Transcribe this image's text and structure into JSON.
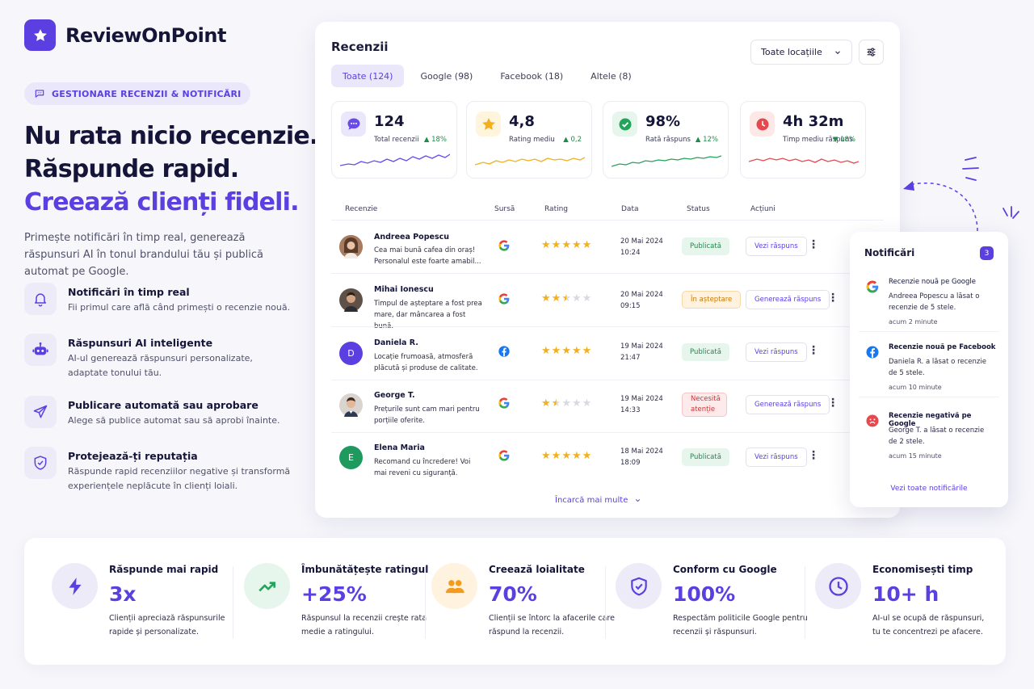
{
  "brand": {
    "name": "ReviewOnPoint"
  },
  "hero": {
    "pill": "GESTIONARE RECENZII & NOTIFICĂRI",
    "line1": "Nu rata nicio recenzie.",
    "line2": "Răspunde rapid.",
    "line3": "Creează clienți fideli.",
    "subtitle": "Primește notificări în timp real, generează răspunsuri AI în tonul brandului tău și publică automat pe Google."
  },
  "features": [
    {
      "title": "Notificări în timp real",
      "desc": "Fii primul care află când primești o recenzie nouă.",
      "icon": "bell-icon"
    },
    {
      "title": "Răspunsuri AI inteligente",
      "desc": "AI-ul generează răspunsuri personalizate, adaptate tonului tău.",
      "icon": "robot-icon"
    },
    {
      "title": "Publicare automată sau aprobare",
      "desc": "Alege să publice automat sau să aprobi înainte.",
      "icon": "send-icon"
    },
    {
      "title": "Protejează-ți reputația",
      "desc": "Răspunde rapid recenziilor negative și transformă experiențele neplăcute în clienți loiali.",
      "icon": "shield-icon"
    }
  ],
  "panel": {
    "title": "Recenzii",
    "location": "Toate locațiile",
    "tabs": [
      "Toate (124)",
      "Google (98)",
      "Facebook (18)",
      "Altele (8)"
    ],
    "load_more": "Încarcă mai multe"
  },
  "kpis": [
    {
      "value": "124",
      "label": "Total recenzii",
      "delta": "▲ 18%",
      "color": "#6b4be8",
      "delta_color": "#1f8a4a",
      "icon": "chat-icon"
    },
    {
      "value": "4,8",
      "label": "Rating mediu",
      "delta": "▲ 0,2",
      "color": "#f2b01e",
      "delta_color": "#1f8a4a",
      "icon": "star-icon"
    },
    {
      "value": "98%",
      "label": "Rată răspuns",
      "delta": "▲ 12%",
      "color": "#22a45a",
      "delta_color": "#1f8a4a",
      "icon": "check-icon"
    },
    {
      "value": "4h 32m",
      "label": "Timp mediu răspuns",
      "delta": "▼ 18%",
      "color": "#e5484d",
      "delta_color": "#1f8a4a",
      "icon": "clock-icon"
    }
  ],
  "table": {
    "headers": [
      "Recenzie",
      "Sursă",
      "Rating",
      "Data",
      "Status",
      "Acțiuni"
    ],
    "rows": [
      {
        "name": "Andreea Popescu",
        "text": "Cea mai bună cafea din oraș! Personalul este foarte amabil...",
        "source": "google",
        "rating": 5,
        "date": "20 Mai 2024",
        "time": "10:24",
        "status": "Publicată",
        "status_type": "pub",
        "action": "Vezi răspuns",
        "initial": "",
        "avatar_color": "#b98867"
      },
      {
        "name": "Mihai Ionescu",
        "text": "Timpul de așteptare a fost prea mare, dar mâncarea a fost bună.",
        "source": "google",
        "rating": 2.5,
        "date": "20 Mai 2024",
        "time": "09:15",
        "status": "În așteptare",
        "status_type": "wait",
        "action": "Generează răspuns",
        "initial": "",
        "avatar_color": "#6f5b4c"
      },
      {
        "name": "Daniela R.",
        "text": "Locație frumoasă, atmosferă plăcută și produse de calitate.",
        "source": "facebook",
        "rating": 5,
        "date": "19 Mai 2024",
        "time": "21:47",
        "status": "Publicată",
        "status_type": "pub",
        "action": "Vezi răspuns",
        "initial": "D",
        "avatar_color": "#5b3fe0"
      },
      {
        "name": "George T.",
        "text": "Prețurile sunt cam mari pentru porțiile oferite.",
        "source": "google",
        "rating": 1.5,
        "date": "19 Mai 2024",
        "time": "14:33",
        "status": "Necesită atenție",
        "status_type": "need",
        "action": "Generează răspuns",
        "initial": "",
        "avatar_color": "#8a7a70"
      },
      {
        "name": "Elena Maria",
        "text": "Recomand cu încredere! Voi mai reveni cu siguranță.",
        "source": "google",
        "rating": 5,
        "date": "18 Mai 2024",
        "time": "18:09",
        "status": "Publicată",
        "status_type": "pub",
        "action": "Vezi răspuns",
        "initial": "E",
        "avatar_color": "#1f9a5e"
      }
    ]
  },
  "notifications": {
    "title": "Notificări",
    "count": "3",
    "items": [
      {
        "head": "Recenzie nouă pe Google",
        "body": "Andreea Popescu a lăsat o recenzie de 5 stele.",
        "time": "acum 2 minute",
        "icon": "google"
      },
      {
        "head": "Recenzie nouă pe Facebook",
        "body": "Daniela R. a lăsat o recenzie de 5 stele.",
        "time": "acum 10 minute",
        "icon": "facebook"
      },
      {
        "head": "Recenzie negativă pe Google",
        "body": "George T. a lăsat o recenzie de 2 stele.",
        "time": "acum 15 minute",
        "icon": "sad"
      }
    ],
    "see_all": "Vezi toate notificările"
  },
  "stats": [
    {
      "title": "Răspunde mai rapid",
      "value": "3x",
      "desc": "Clienții apreciază răspunsurile rapide și personalizate.",
      "icon": "lightning-icon",
      "bg": "#ecebf7"
    },
    {
      "title": "Îmbunătățește ratingul",
      "value": "+25%",
      "desc": "Răspunsul la recenzii crește rata medie a ratingului.",
      "icon": "trend-up-icon",
      "bg": "#e6f6ec"
    },
    {
      "title": "Creează loialitate",
      "value": "70%",
      "desc": "Clienții se întorc la afacerile care răspund la recenzii.",
      "icon": "users-icon",
      "bg": "#fff3e0"
    },
    {
      "title": "Conform cu Google",
      "value": "100%",
      "desc": "Respectăm politicile Google pentru recenzii și răspunsuri.",
      "icon": "shield-check-icon",
      "bg": "#ecebf7"
    },
    {
      "title": "Economisești timp",
      "value": "10+ h",
      "desc": "AI-ul se ocupă de răspunsuri, tu te concentrezi pe afacere.",
      "icon": "clock-icon",
      "bg": "#ecebf7"
    }
  ]
}
